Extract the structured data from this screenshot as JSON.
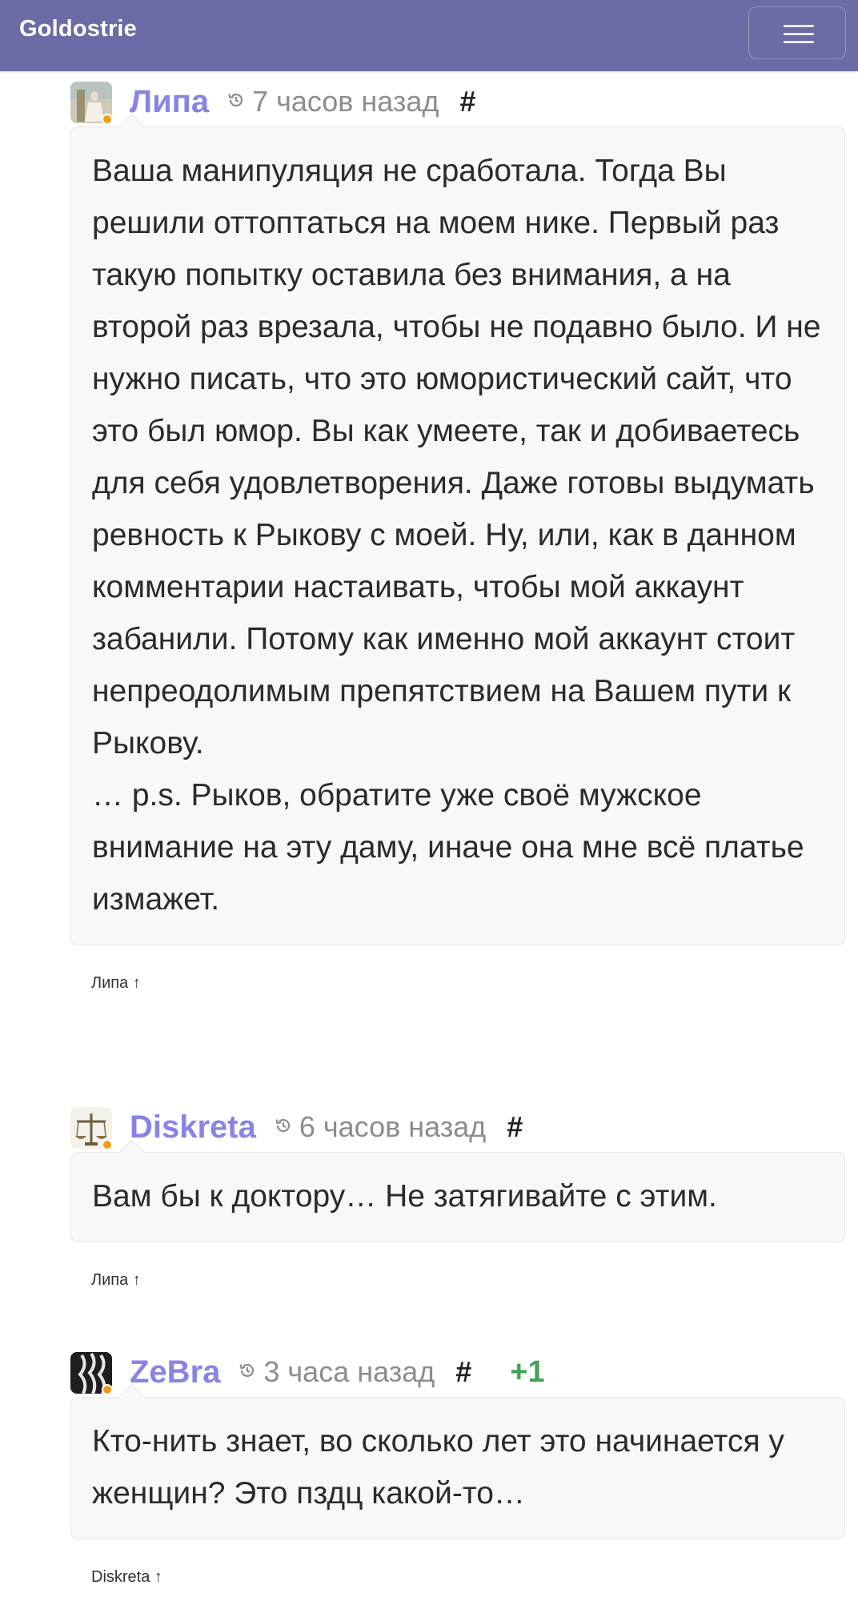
{
  "navbar": {
    "brand": "Goldostrie",
    "menu_icon": "hamburger-menu-icon"
  },
  "comments": [
    {
      "username": "Липа",
      "time": "7 часов назад",
      "anchor": "#",
      "score": "",
      "text": "Ваша манипуляция не сработала. Тогда Вы решили оттоптаться на моем нике. Первый раз такую попытку оставила без внимания, а на второй раз врезала, чтобы не подавно было. И не нужно писать, что это юмористический сайт, что это был юмор. Вы как умеете, так и добиваетесь для себя удовлетворения. Даже готовы выдумать ревность к Рыкову с моей. Ну, или, как в данном комментарии настаивать, чтобы мой аккаунт забанили. Потому как именно мой аккаунт стоит непреодолимым препятствием на Вашем пути к Рыкову.\n… p.s. Рыков, обратите уже своё мужское внимание на эту даму, иначе она мне всё платье измажет.",
      "reply_to": "Липа ↑"
    },
    {
      "username": "Diskreta",
      "time": "6 часов назад",
      "anchor": "#",
      "score": "",
      "text": "Вам бы к доктору… Не затягивайте с этим.",
      "reply_to": "Липа ↑"
    },
    {
      "username": "ZeBra",
      "time": "3 часа назад",
      "anchor": "#",
      "score": "+1",
      "text": "Кто-нить знает, во сколько лет это начинается у женщин? Это пздц какой-то…",
      "reply_to": "Diskreta ↑"
    }
  ],
  "colors": {
    "navbar": "#6b6ba6",
    "username": "#8a83e6",
    "score_positive": "#43a357",
    "online_dot": "#f39c12"
  }
}
